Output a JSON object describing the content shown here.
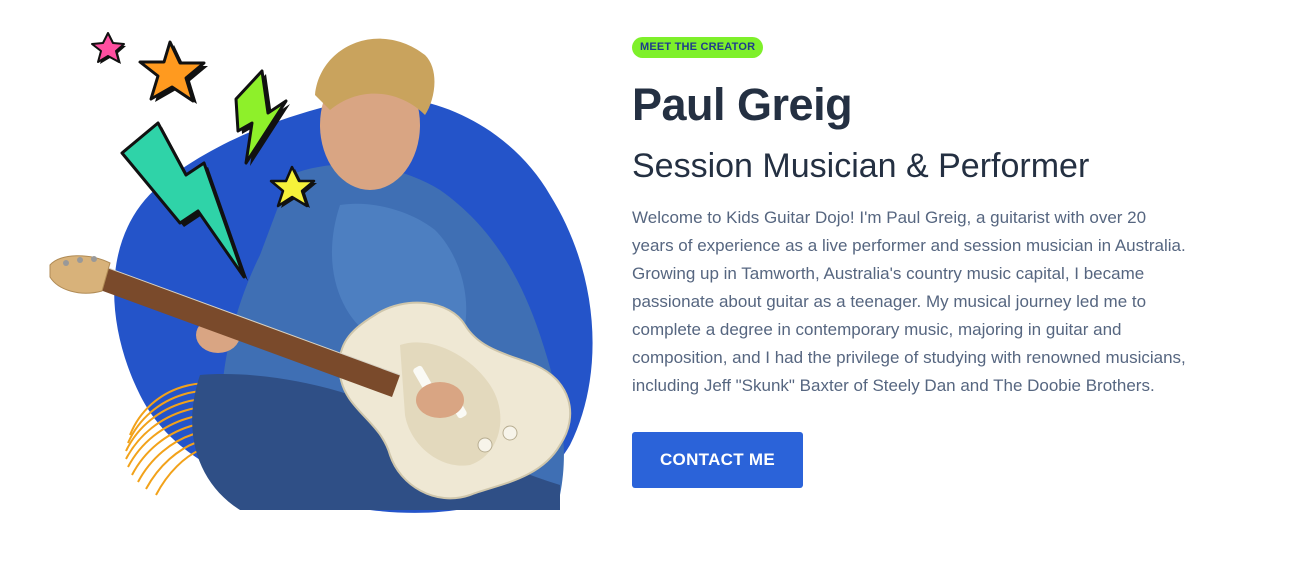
{
  "creator": {
    "badge": "MEET THE CREATOR",
    "name": "Paul Greig",
    "role": "Session Musician & Performer",
    "bio": "Welcome to Kids Guitar Dojo! I'm Paul Greig, a guitarist with over 20 years of experience as a live performer and session musician in Australia. Growing up in Tamworth, Australia's country music capital, I became passionate about guitar as a teenager. My musical journey led me to complete a degree in contemporary music, majoring in guitar and composition, and I had the privilege of studying with renowned musicians, including Jeff \"Skunk\" Baxter of Steely Dan and The Doobie Brothers.",
    "button_label": "CONTACT ME"
  },
  "colors": {
    "accent": "#2b63d9",
    "badge_bg": "#7ef02a",
    "heading": "#243042",
    "body_text": "#566680",
    "blob": "#2454c9"
  },
  "illustration": {
    "elements": [
      "blue-blob",
      "guitarist-photo",
      "pink-star-icon",
      "orange-star-icon",
      "yellow-star-icon",
      "green-lightning-icon",
      "teal-lightning-icon",
      "orange-line-swirl"
    ]
  }
}
